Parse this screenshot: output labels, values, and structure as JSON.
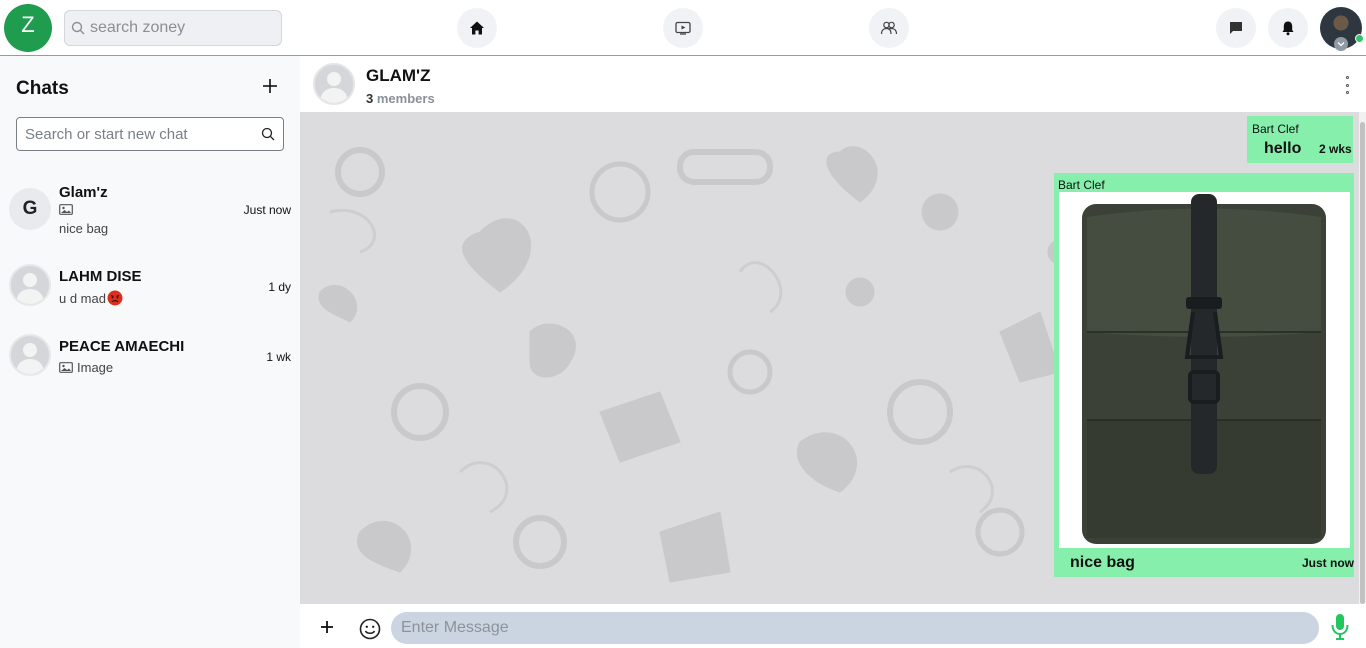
{
  "topbar": {
    "logo_letter": "Z",
    "search_placeholder": "search zoney",
    "nav": [
      {
        "name": "home",
        "icon": "home-icon"
      },
      {
        "name": "watch",
        "icon": "video-icon"
      },
      {
        "name": "groups",
        "icon": "people-icon"
      }
    ],
    "right_icons": [
      "chat-icon",
      "bell-icon",
      "avatar"
    ]
  },
  "sidebar": {
    "title": "Chats",
    "search_placeholder": "Search or start new chat",
    "chats": [
      {
        "name": "Glam'z",
        "avatar_letter": "G",
        "media_icon": "image-icon",
        "preview": "nice bag",
        "time": "Just now"
      },
      {
        "name": "LAHM DISE",
        "preview": "u d mad",
        "preview_emoji": "angry-face-emoji",
        "time": "1 dy"
      },
      {
        "name": "PEACE AMAECHI",
        "media_icon": "image-icon",
        "preview": "Image",
        "time": "1 wk"
      }
    ]
  },
  "conversation": {
    "title": "GLAM'Z",
    "member_count": "3",
    "member_label": "members",
    "messages": [
      {
        "sender": "Bart Clef",
        "text": "hello",
        "time": "2 wks"
      },
      {
        "sender": "Bart Clef",
        "image": "green-backpack-photo",
        "text": "nice bag",
        "time": "Just now"
      }
    ],
    "bubble_color": "#86efac"
  },
  "composer": {
    "placeholder": "Enter Message"
  },
  "colors": {
    "brand": "#1f9c4d",
    "bubble": "#86efac",
    "mic": "#22c55e",
    "wallpaper": "#dcdbdd"
  }
}
